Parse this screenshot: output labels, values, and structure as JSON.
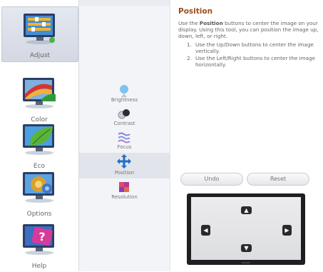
{
  "categories": [
    {
      "id": "adjust",
      "label": "Adjust",
      "active": true
    },
    {
      "id": "color",
      "label": "Color",
      "active": false
    },
    {
      "id": "eco",
      "label": "Eco",
      "active": false
    },
    {
      "id": "options",
      "label": "Options",
      "active": false
    },
    {
      "id": "help",
      "label": "Help",
      "active": false
    }
  ],
  "submenu": [
    {
      "id": "brightness",
      "label": "Brightness",
      "active": false
    },
    {
      "id": "contrast",
      "label": "Contrast",
      "active": false
    },
    {
      "id": "focus",
      "label": "Focus",
      "active": false
    },
    {
      "id": "position",
      "label": "Position",
      "active": true
    },
    {
      "id": "resolution",
      "label": "Resolution",
      "active": false
    }
  ],
  "panel": {
    "title": "Position",
    "desc_pre": "Use the ",
    "desc_bold": "Position",
    "desc_post": " buttons to center the image on your display. Using this tool, you can position the image up, down, left, or right.",
    "steps": [
      {
        "n": "1.",
        "text": "Use the Up/Down buttons to center the image vertically."
      },
      {
        "n": "2.",
        "text": "Use the Left/Right buttons to center the image horizontally."
      }
    ],
    "undo_label": "Undo",
    "reset_label": "Reset",
    "brand": "PHILIPS"
  },
  "colors": {
    "title": "#9b4d1a",
    "accent": "#1f6fc9"
  }
}
